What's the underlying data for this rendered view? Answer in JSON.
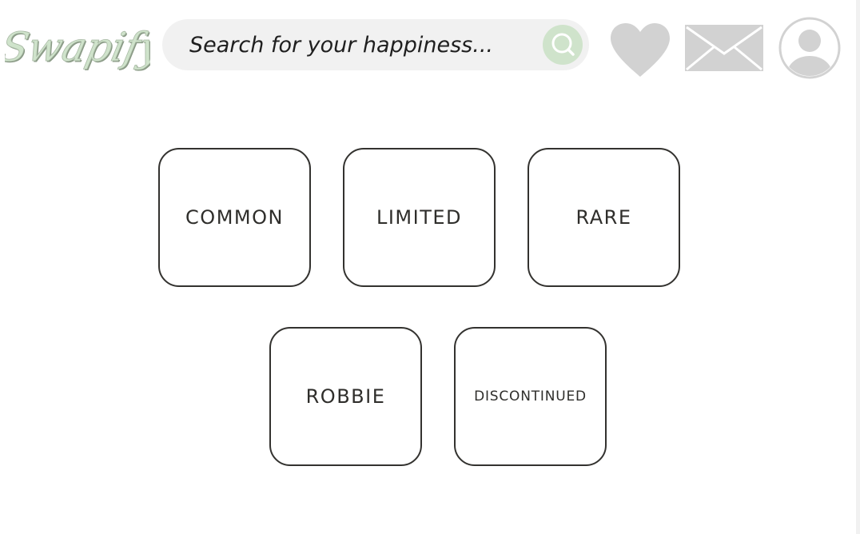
{
  "header": {
    "logo_text": "Swapify",
    "search": {
      "placeholder": "Search for your happiness...",
      "value": ""
    },
    "icons": {
      "search": "search-icon",
      "favorites": "heart-icon",
      "messages": "mail-icon",
      "profile": "profile-icon"
    }
  },
  "categories": [
    {
      "label": "COMMON"
    },
    {
      "label": "LIMITED"
    },
    {
      "label": "RARE"
    },
    {
      "label": "ROBBIE"
    },
    {
      "label": "DISCONTINUED"
    }
  ],
  "colors": {
    "accent_green": "#cfe3cb",
    "logo_green": "#c9dfc4",
    "search_bg": "#f1f1f1",
    "icon_gray": "#d2d2d2",
    "tile_border": "#33322f",
    "text_dark": "#2f2e2b"
  }
}
